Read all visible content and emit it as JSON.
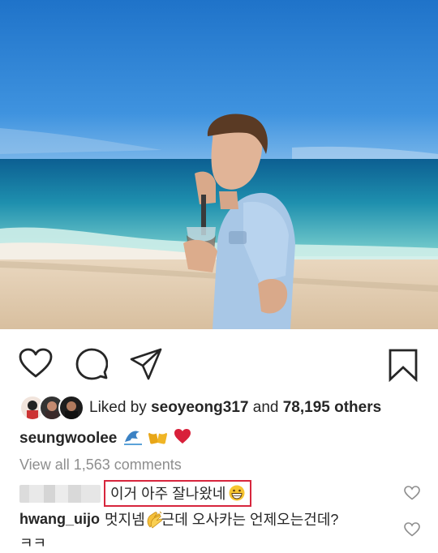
{
  "post": {
    "liked_by_prefix": "Liked by",
    "liked_by_user": "seoyeong317",
    "liked_and": "and",
    "liked_others": "78,195 others",
    "caption_user": "seungwoolee",
    "view_all": "View all 1,563 comments",
    "comments": [
      {
        "user": "",
        "text": "이거 아주 잘나왔네",
        "highlighted": true,
        "emoji": "grinning-face"
      },
      {
        "user": "hwang_uijo",
        "text_before": "멋지넴",
        "emoji": "clapping-hands",
        "text_after": " 근데 오사카는 언제오는건데?"
      },
      {
        "user": "",
        "text": "ㅋㅋ"
      }
    ]
  },
  "icons": [
    "heart-icon",
    "comment-icon",
    "share-icon",
    "bookmark-icon",
    "wave-emoji",
    "beer-emoji",
    "red-heart-emoji"
  ],
  "colors": {
    "highlight_border": "#d7263d",
    "muted_text": "#8e8e8e",
    "text": "#262626"
  }
}
